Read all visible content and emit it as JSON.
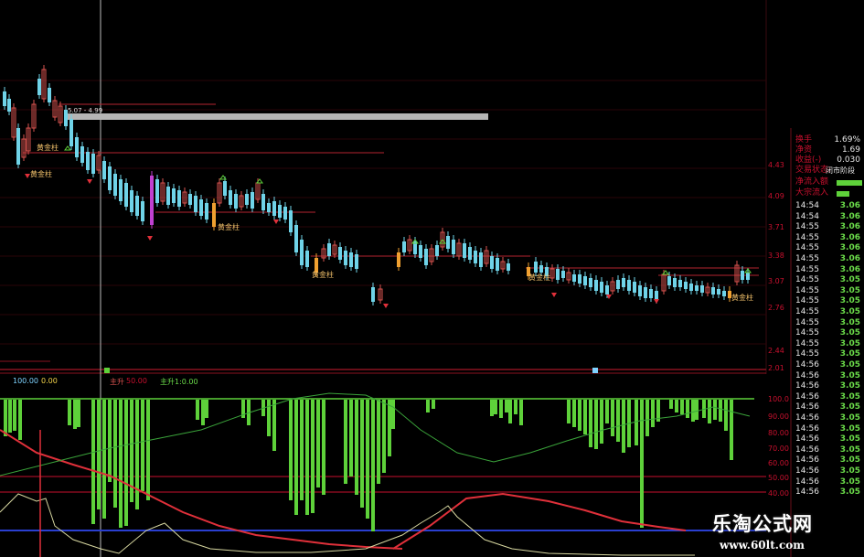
{
  "price_axis": [
    "4.43",
    "4.09",
    "3.71",
    "3.38",
    "3.07",
    "2.76",
    "2.44",
    "2.01"
  ],
  "indicator_axis": [
    "100.0",
    "90.00",
    "80.00",
    "70.00",
    "60.00",
    "50.00",
    "40.00"
  ],
  "range_label": "5.07 - 4.99",
  "signal_labels": {
    "gold": "黄金柱",
    "sample": "黄金柱"
  },
  "indicator_header": [
    "100.00",
    "0.00",
    "主升",
    "50.00",
    "主升1:0.00"
  ],
  "info_panel": [
    {
      "key": "换手",
      "value": "1.69%"
    },
    {
      "key": "净资",
      "value": "1.69"
    },
    {
      "key": "收益(-)",
      "value": "0.030"
    },
    {
      "key": "交易状态:",
      "value": "闭市阶段"
    },
    {
      "key": "净流入额",
      "value": ""
    },
    {
      "key": "大宗流入",
      "value": ""
    }
  ],
  "ticks": [
    {
      "time": "14:54",
      "price": "3.06"
    },
    {
      "time": "14:54",
      "price": "3.06"
    },
    {
      "time": "14:55",
      "price": "3.06"
    },
    {
      "time": "14:55",
      "price": "3.06"
    },
    {
      "time": "14:55",
      "price": "3.06"
    },
    {
      "time": "14:55",
      "price": "3.06"
    },
    {
      "time": "14:55",
      "price": "3.06"
    },
    {
      "time": "14:55",
      "price": "3.05"
    },
    {
      "time": "14:55",
      "price": "3.05"
    },
    {
      "time": "14:55",
      "price": "3.05"
    },
    {
      "time": "14:55",
      "price": "3.05"
    },
    {
      "time": "14:55",
      "price": "3.05"
    },
    {
      "time": "14:55",
      "price": "3.05"
    },
    {
      "time": "14:55",
      "price": "3.05"
    },
    {
      "time": "14:55",
      "price": "3.05"
    },
    {
      "time": "14:56",
      "price": "3.05"
    },
    {
      "time": "14:56",
      "price": "3.05"
    },
    {
      "time": "14:56",
      "price": "3.05"
    },
    {
      "time": "14:56",
      "price": "3.05"
    },
    {
      "time": "14:56",
      "price": "3.05"
    },
    {
      "time": "14:56",
      "price": "3.05"
    },
    {
      "time": "14:56",
      "price": "3.05"
    },
    {
      "time": "14:56",
      "price": "3.05"
    },
    {
      "time": "14:56",
      "price": "3.05"
    },
    {
      "time": "14:56",
      "price": "3.05"
    },
    {
      "time": "14:56",
      "price": "3.05"
    },
    {
      "time": "14:56",
      "price": "3.05"
    },
    {
      "time": "14:56",
      "price": "3.05"
    }
  ],
  "watermark": {
    "title": "乐淘公式网",
    "url": "www.60lt.com"
  },
  "colors": {
    "up": "#d9534f",
    "down": "#6fd3e8",
    "grid": "#6a0f1a",
    "bar": "#5ed13a",
    "magenta": "#c040d0"
  }
}
